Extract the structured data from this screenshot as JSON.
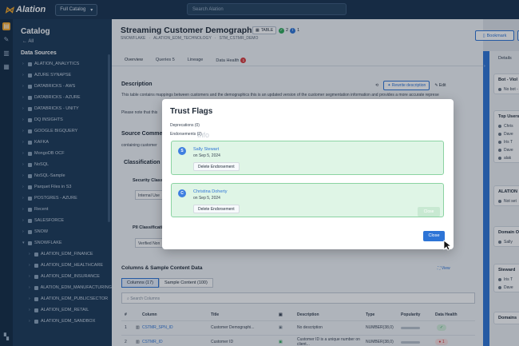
{
  "app": {
    "name": "Alation",
    "catalog_select": "Full Catalog",
    "search_placeholder": "Search Alation"
  },
  "sidebar": {
    "title": "Catalog",
    "all_link": "All",
    "section": "Data Sources",
    "items": [
      {
        "label": "ALATION_ANALYTICS",
        "child": false
      },
      {
        "label": "AZURE SYNAPSE",
        "child": false
      },
      {
        "label": "DATABRICKS - AWS",
        "child": false
      },
      {
        "label": "DATABRICKS - AZURE",
        "child": false
      },
      {
        "label": "DATABRICKS - UNITY",
        "child": false
      },
      {
        "label": "DQ INSIGHTS",
        "child": false
      },
      {
        "label": "GOOGLE BIGQUERY",
        "child": false
      },
      {
        "label": "KAFKA",
        "child": false
      },
      {
        "label": "MongoDB OCF",
        "child": false
      },
      {
        "label": "NoSQL",
        "child": false
      },
      {
        "label": "NoSQL-Sample",
        "child": false
      },
      {
        "label": "Parquet Files in S3",
        "child": false
      },
      {
        "label": "POSTGRES - AZURE",
        "child": false
      },
      {
        "label": "Recent",
        "child": false
      },
      {
        "label": "SALESFORCE",
        "child": false
      },
      {
        "label": "SNOW",
        "child": false
      },
      {
        "label": "SNOWFLAKE",
        "child": false
      },
      {
        "label": "ALATION_EDM_FINANCE",
        "child": true
      },
      {
        "label": "ALATION_EDM_HEALTHCARE",
        "child": true
      },
      {
        "label": "ALATION_EDM_INSURANCE",
        "child": true
      },
      {
        "label": "ALATION_EDM_MANUFACTURING",
        "child": true
      },
      {
        "label": "ALATION_EDM_PUBLICSECTOR",
        "child": true
      },
      {
        "label": "ALATION_EDM_RETAIL",
        "child": true
      },
      {
        "label": "ALATION_EDM_SANDBOX",
        "child": true
      }
    ]
  },
  "page": {
    "title": "Streaming Customer Demographics",
    "type_badge": "TABLE",
    "count_green": "2",
    "count_blue": "1",
    "breadcrumb": [
      "SNOWFLAKE",
      "ALATION_EDM_TECHNOLOGY",
      "STM_CSTMR_DEMO"
    ],
    "tabs": [
      {
        "label": "Overview"
      },
      {
        "label": "Queries",
        "count": "5"
      },
      {
        "label": "Lineage"
      },
      {
        "label": "Data Health",
        "badge": "1"
      }
    ],
    "bookmark_label": "Bookmark",
    "description_heading": "Description",
    "rewrite_label": "Rewrite description",
    "edit_label": "Edit",
    "description_text": "This table contains mappings between customers and the demographics this is an updated version of the customer segmentation information and provides a more accurate represe",
    "description_note": "Please note that this",
    "source_heading": "Source Commen",
    "source_text": "containing customer",
    "classification_heading": "Classification",
    "security_label": "Security Classi",
    "security_value": "Internal Use",
    "pii_label": "PII Classification",
    "pii_value": "Verified Non"
  },
  "columns": {
    "heading": "Columns & Sample Content Data",
    "view_label": "View",
    "tabs": [
      "Columns (17)",
      "Sample Content (100)"
    ],
    "search_placeholder": "Search Columns",
    "headers": [
      "#",
      "Column",
      "Title",
      "Description",
      "Type",
      "Popularity",
      "Data Health"
    ],
    "rows": [
      {
        "num": "1",
        "column": "CSTMR_SPN_ID",
        "title": "Customer Demographi...",
        "description": "No description",
        "type": "NUMBER(38,0)",
        "health": "ok"
      },
      {
        "num": "2",
        "column": "CSTMR_ID",
        "title": "Customer ID",
        "description": "Customer ID is a unique number on client...",
        "type": "NUMBER(38,0)",
        "health": "1"
      }
    ]
  },
  "right_panel": {
    "tab": "Details",
    "cards": [
      {
        "heading": "Bot - Viol",
        "lines": [
          "No bot - vi"
        ]
      },
      {
        "heading": "Top Users",
        "lines": [
          "Chris",
          "Dave",
          "Iris T",
          "Dave",
          "alak"
        ]
      },
      {
        "heading": "ALATION",
        "lines": [
          "Not set"
        ]
      },
      {
        "heading": "Domain O",
        "lines": [
          "Sally"
        ]
      },
      {
        "heading": "Steward",
        "lines": [
          "Iris T",
          "Dave"
        ]
      },
      {
        "heading": "Domains",
        "lines": []
      }
    ]
  },
  "modal": {
    "title": "Trust Flags",
    "deprecations": "Deprecations (0)",
    "endorsements": "Endorsements (2)",
    "ghost_info": "Info",
    "endorsements_list": [
      {
        "initial": "S",
        "name": "Sally Stewart",
        "date": "on Sep 5, 2024",
        "delete_label": "Delete Endorsement"
      },
      {
        "initial": "C",
        "name": "Christina Doherty",
        "date": "on Sep 5, 2024",
        "delete_label": "Delete Endorsement"
      }
    ],
    "ghost_button": "Close",
    "close_label": "Close"
  },
  "colors": {
    "topbar": "#17324e",
    "sidebar": "#1b3856",
    "accent": "#2d74d6",
    "brand_orange": "#f5a524",
    "endorse_bg": "#dff5e6",
    "endorse_border": "#8bd3a2",
    "danger": "#d9383a",
    "success": "#2fa85a"
  }
}
